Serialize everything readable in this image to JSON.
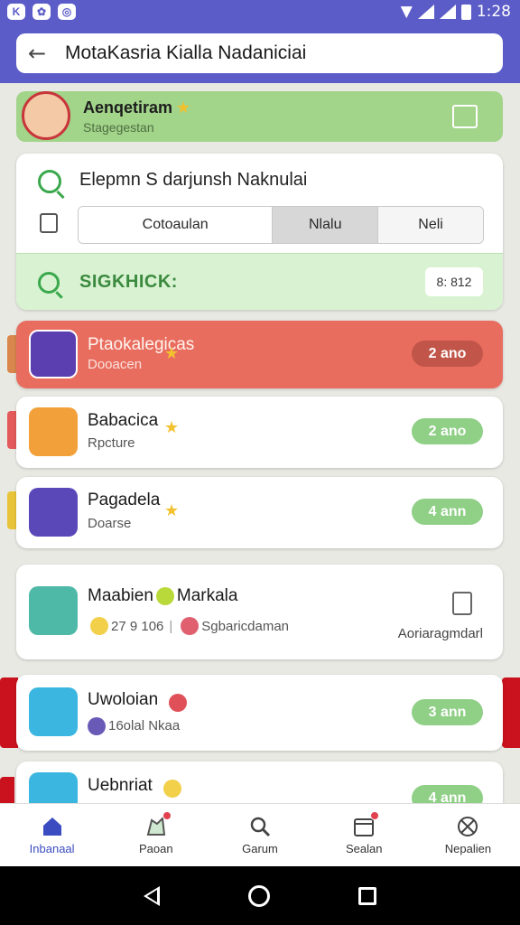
{
  "status_bar": {
    "time": "1:28",
    "icons": [
      "app-icon",
      "leaf-icon",
      "record-icon",
      "wifi-icon",
      "signal-icon",
      "battery-icon"
    ]
  },
  "search": {
    "query": "MotaKasria Kialla Nadaniciai",
    "back_icon": "arrow-left-icon"
  },
  "banner": {
    "title": "Aenqetiram",
    "subtitle": "Stagegestan"
  },
  "search_card": {
    "title": "Elepmn S darjunsh Naknulai",
    "tabs": [
      "Cotoaulan",
      "Nlalu",
      "Neli"
    ],
    "filter_label": "SIGKHICK:",
    "filter_value": "8: 812"
  },
  "items": [
    {
      "title": "Ptaokalegicas",
      "subtitle": "Dooacen",
      "badge": "2 ano",
      "accent": "#e86d5f"
    },
    {
      "title": "Babacica",
      "subtitle": "Rpcture",
      "badge": "2 ano",
      "accent": "#8fcf86"
    },
    {
      "title": "Pagadela",
      "subtitle": "Doarse",
      "badge": "4 ann",
      "accent": "#8fcf86"
    },
    {
      "title": "Maabien",
      "title2": "Markala",
      "meta_number": "27 9 106",
      "meta_label": "Sgbaricdaman",
      "doc_label": "Aoriaragmdarl"
    },
    {
      "title": "Uwoloian",
      "subtitle": "16olal Nkaa",
      "badge": "3 ann",
      "accent": "#8fcf86"
    },
    {
      "title": "Uebnriat",
      "badge": "4 ann",
      "accent": "#8fcf86"
    }
  ],
  "bottom_nav": [
    {
      "label": "Inbanaal",
      "icon": "home-icon",
      "active": true
    },
    {
      "label": "Paoan",
      "icon": "map-pin-icon",
      "active": false
    },
    {
      "label": "Garum",
      "icon": "search-icon",
      "active": false
    },
    {
      "label": "Sealan",
      "icon": "calendar-icon",
      "active": false
    },
    {
      "label": "Nepalien",
      "icon": "globe-icon",
      "active": false
    }
  ],
  "colors": {
    "primary": "#5c5cc8",
    "green": "#8fcf86",
    "red": "#e86d5f",
    "active_nav": "#3b4cc0"
  }
}
